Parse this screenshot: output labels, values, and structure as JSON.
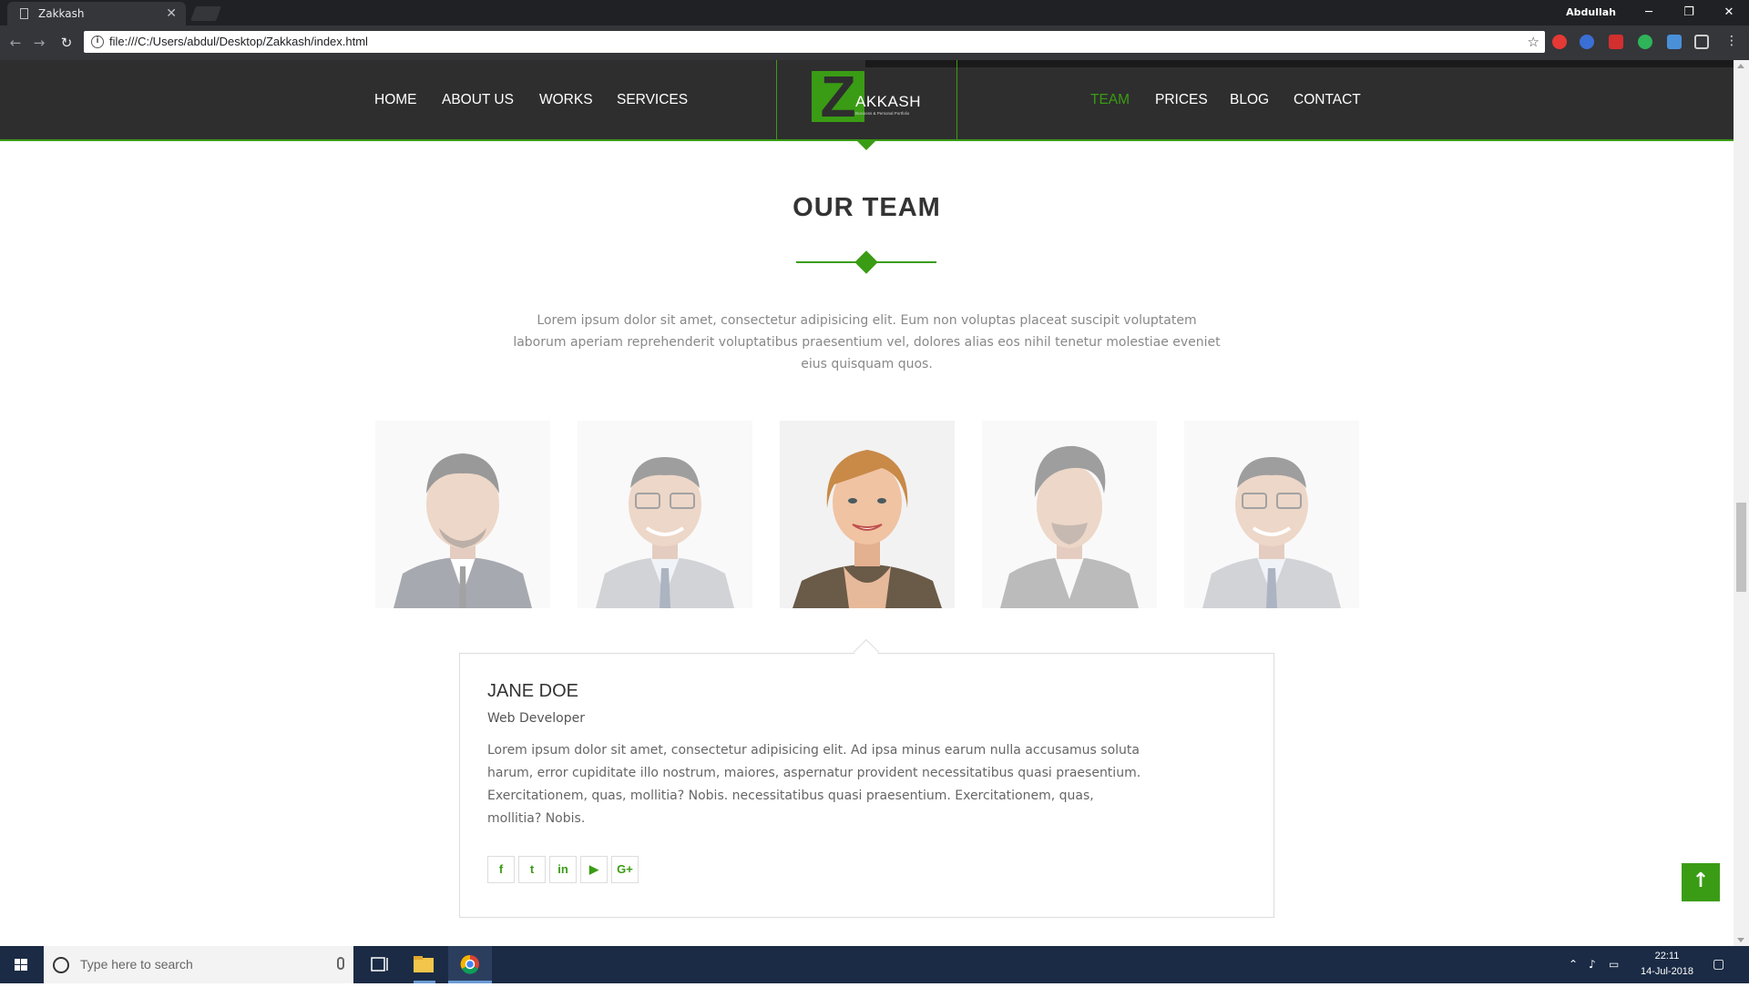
{
  "browser": {
    "tab_title": "Zakkash",
    "url": "file:///C:/Users/abdul/Desktop/Zakkash/index.html",
    "user": "Abdullah"
  },
  "site": {
    "nav_left": [
      "HOME",
      "ABOUT US",
      "WORKS",
      "SERVICES"
    ],
    "nav_right": [
      "TEAM",
      "PRICES",
      "BLOG",
      "CONTACT"
    ],
    "active_nav": "TEAM",
    "logo_letter": "Z",
    "logo_word": "AKKASH",
    "logo_tagline": "Business & Personal Portfolio",
    "accent_color": "#3a9c14"
  },
  "team": {
    "title": "OUR TEAM",
    "intro": "Lorem ipsum dolor sit amet, consectetur adipisicing elit. Eum non voluptas placeat suscipit voluptatem laborum aperiam reprehenderit voluptatibus praesentium vel, dolores alias eos nihil tenetur molestiae eveniet eius quisquam quos.",
    "selected": {
      "name": "JANE DOE",
      "role": "Web Developer",
      "bio": "Lorem ipsum dolor sit amet, consectetur adipisicing elit. Ad ipsa minus earum nulla accusamus soluta harum, error cupiditate illo nostrum, maiores, aspernatur provident necessitatibus quasi praesentium. Exercitationem, quas, mollitia? Nobis. necessitatibus quasi praesentium. Exercitationem, quas, mollitia? Nobis.",
      "social": [
        "f",
        "t",
        "in",
        "▶",
        "G+"
      ]
    }
  },
  "taskbar": {
    "search_placeholder": "Type here to search",
    "time": "22:11",
    "date": "14-Jul-2018"
  }
}
